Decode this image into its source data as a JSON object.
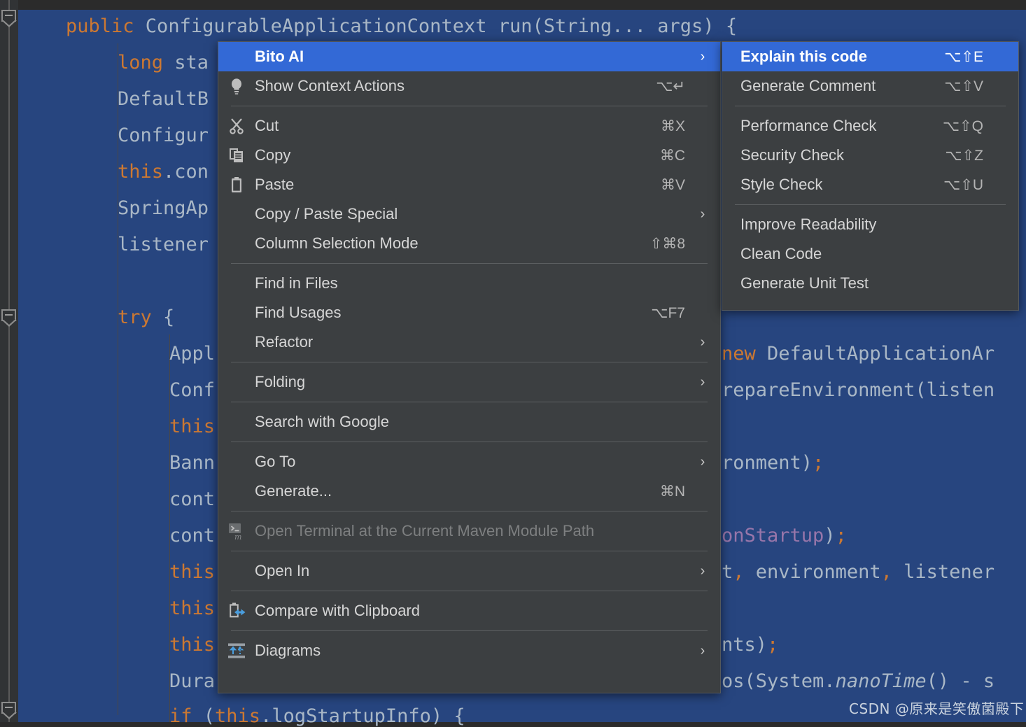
{
  "editor": {
    "language": "java",
    "selection_color": "#27457f",
    "background": "#2b2b2b",
    "keyword_color": "#cc7832",
    "text_color": "#a9b7c6",
    "lines": [
      "public ConfigurableApplicationContext run(String... args) {",
      "    long sta",
      "    DefaultB",
      "    Configur",
      "    this.con",
      "    SpringAp",
      "    listener",
      "",
      "    try {",
      "        Appl",
      "        Conf",
      "        this",
      "        Bann",
      "        cont",
      "        cont",
      "        this",
      "        this",
      "        this",
      "        Dura",
      "        if (this.logStartupInfo) {"
    ],
    "right_fragments": [
      "new DefaultApplicationAr",
      "repareEnvironment(listen",
      "ronment);",
      "onStartup);",
      "t, environment, listener",
      "nts);",
      "os(System.nanoTime() - s"
    ]
  },
  "context_menu": {
    "name": "editor-context-menu",
    "items": [
      {
        "label": "Bito AI",
        "accel": "",
        "icon": "none",
        "submenu": true,
        "selected": true,
        "disabled": false
      },
      {
        "label": "Show Context Actions",
        "accel": "⌥↵",
        "icon": "lightbulb-icon",
        "submenu": false,
        "selected": false,
        "disabled": false
      },
      {
        "separator": true
      },
      {
        "label": "Cut",
        "accel": "⌘X",
        "icon": "scissors-icon",
        "submenu": false,
        "selected": false,
        "disabled": false
      },
      {
        "label": "Copy",
        "accel": "⌘C",
        "icon": "copy-icon",
        "submenu": false,
        "selected": false,
        "disabled": false
      },
      {
        "label": "Paste",
        "accel": "⌘V",
        "icon": "clipboard-icon",
        "submenu": false,
        "selected": false,
        "disabled": false
      },
      {
        "label": "Copy / Paste Special",
        "accel": "",
        "icon": "none",
        "submenu": true,
        "selected": false,
        "disabled": false
      },
      {
        "label": "Column Selection Mode",
        "accel": "⇧⌘8",
        "icon": "none",
        "submenu": false,
        "selected": false,
        "disabled": false
      },
      {
        "separator": true
      },
      {
        "label": "Find in Files",
        "accel": "",
        "icon": "none",
        "submenu": false,
        "selected": false,
        "disabled": false
      },
      {
        "label": "Find Usages",
        "accel": "⌥F7",
        "icon": "none",
        "submenu": false,
        "selected": false,
        "disabled": false
      },
      {
        "label": "Refactor",
        "accel": "",
        "icon": "none",
        "submenu": true,
        "selected": false,
        "disabled": false
      },
      {
        "separator": true
      },
      {
        "label": "Folding",
        "accel": "",
        "icon": "none",
        "submenu": true,
        "selected": false,
        "disabled": false
      },
      {
        "separator": true
      },
      {
        "label": "Search with Google",
        "accel": "",
        "icon": "none",
        "submenu": false,
        "selected": false,
        "disabled": false
      },
      {
        "separator": true
      },
      {
        "label": "Go To",
        "accel": "",
        "icon": "none",
        "submenu": true,
        "selected": false,
        "disabled": false
      },
      {
        "label": "Generate...",
        "accel": "⌘N",
        "icon": "none",
        "submenu": false,
        "selected": false,
        "disabled": false
      },
      {
        "separator": true
      },
      {
        "label": "Open Terminal at the Current Maven Module Path",
        "accel": "",
        "icon": "terminal-maven-icon",
        "submenu": false,
        "selected": false,
        "disabled": true
      },
      {
        "separator": true
      },
      {
        "label": "Open In",
        "accel": "",
        "icon": "none",
        "submenu": true,
        "selected": false,
        "disabled": false
      },
      {
        "separator": true
      },
      {
        "label": "Compare with Clipboard",
        "accel": "",
        "icon": "compare-clipboard-icon",
        "submenu": false,
        "selected": false,
        "disabled": false
      },
      {
        "separator": true
      },
      {
        "label": "Diagrams",
        "accel": "",
        "icon": "diagrams-icon",
        "submenu": true,
        "selected": false,
        "disabled": false
      }
    ]
  },
  "submenu": {
    "name": "bito-ai-submenu",
    "items": [
      {
        "label": "Explain this code",
        "accel": "⌥⇧E",
        "selected": true
      },
      {
        "label": "Generate Comment",
        "accel": "⌥⇧V",
        "selected": false
      },
      {
        "separator": true
      },
      {
        "label": "Performance Check",
        "accel": "⌥⇧Q",
        "selected": false
      },
      {
        "label": "Security Check",
        "accel": "⌥⇧Z",
        "selected": false
      },
      {
        "label": "Style Check",
        "accel": "⌥⇧U",
        "selected": false
      },
      {
        "separator": true
      },
      {
        "label": "Improve Readability",
        "accel": "",
        "selected": false
      },
      {
        "label": "Clean Code",
        "accel": "",
        "selected": false
      },
      {
        "label": "Generate Unit Test",
        "accel": "",
        "selected": false
      }
    ]
  },
  "watermark": {
    "text": "CSDN @原来是笑傲菌殿下"
  },
  "colors": {
    "menu_bg": "#3c3f41",
    "menu_border": "#55595b",
    "highlight": "#3369d6",
    "separator": "#5c5f61",
    "disabled_text": "#7d7f80",
    "editor_selection": "#27457f"
  }
}
